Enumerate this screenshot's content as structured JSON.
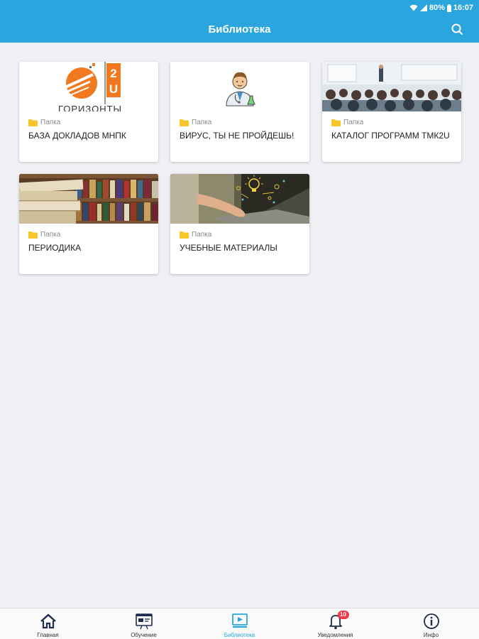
{
  "status_bar": {
    "battery": "80%",
    "time": "16:07"
  },
  "header": {
    "title": "Библиотека"
  },
  "cards": [
    {
      "type_label": "Папка",
      "title": "БАЗА ДОКЛАДОВ МНПК",
      "image": "gorizonty-logo",
      "image_text": "ГОРИЗОНТЫ",
      "logo_badge": "2U"
    },
    {
      "type_label": "Папка",
      "title": "ВИРУС, ТЫ НЕ ПРОЙДЕШЬ!",
      "image": "doctor-illustration"
    },
    {
      "type_label": "Папка",
      "title": "КАТАЛОГ ПРОГРАММ ТМК2U",
      "image": "conference-photo"
    },
    {
      "type_label": "Папка",
      "title": "ПЕРИОДИКА",
      "image": "bookshelf-photo"
    },
    {
      "type_label": "Папка",
      "title": "УЧЕБНЫЕ МАТЕРИАЛЫ",
      "image": "laptop-ideas-photo"
    }
  ],
  "bottom_nav": {
    "items": [
      {
        "label": "Главная",
        "icon": "home-icon"
      },
      {
        "label": "Обучение",
        "icon": "training-icon"
      },
      {
        "label": "Библиотека",
        "icon": "library-icon",
        "active": true
      },
      {
        "label": "Уведомления",
        "icon": "bell-icon",
        "badge": "10"
      },
      {
        "label": "Инфо",
        "icon": "info-icon"
      }
    ]
  },
  "colors": {
    "accent": "#2ba5dd",
    "background": "#efeff4",
    "folder": "#f7c72a",
    "badge": "#ee3b4b"
  }
}
